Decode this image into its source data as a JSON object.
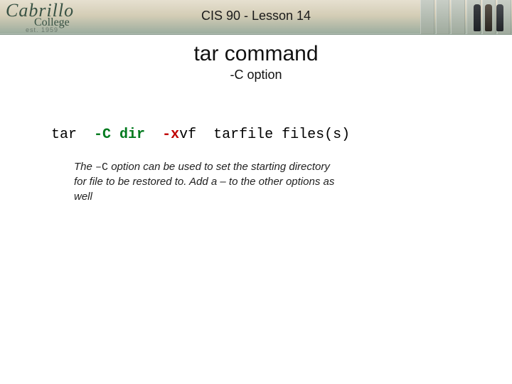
{
  "banner": {
    "logo_main": "Cabrillo",
    "logo_sub": "College",
    "logo_est": "est. 1959",
    "course_title": "CIS 90 - Lesson 14"
  },
  "heading": "tar command",
  "subheading": "-C option",
  "command": {
    "cmd": "tar  ",
    "opt_c": "-C ",
    "dir": "dir",
    "gap": "  ",
    "opt_x": "-x",
    "rest": "vf  tarfile files(s)"
  },
  "desc": {
    "t1": "The ",
    "code": "–C",
    "t2": " option can be used to set the starting directory for file to be restored to.  Add a – to the other options as well"
  }
}
